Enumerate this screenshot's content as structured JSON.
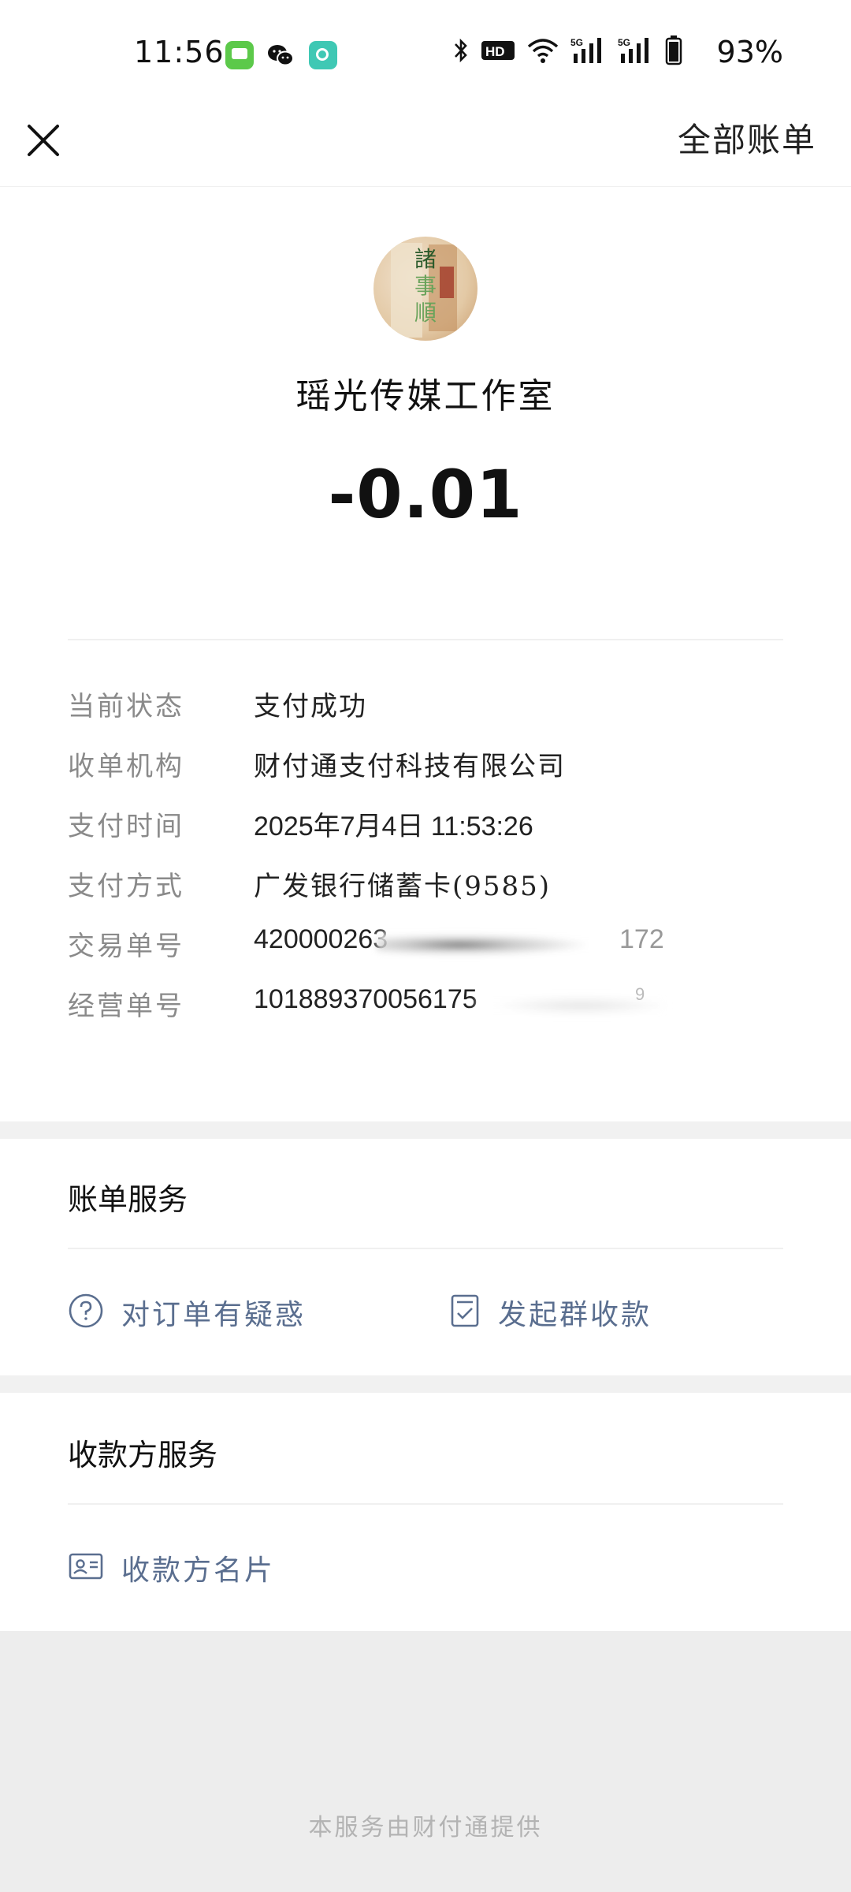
{
  "status_bar": {
    "time": "11:56",
    "battery": "93%",
    "icons": [
      "messages-app-icon",
      "wechat-icon",
      "quark-app-icon",
      "bluetooth-icon",
      "hd-voice-icon",
      "wifi-icon",
      "5g-signal-icon",
      "5g-signal-icon",
      "battery-icon"
    ]
  },
  "nav": {
    "close_icon": "close-icon",
    "all_bills": "全部账单"
  },
  "merchant": {
    "name": "瑶光传媒工作室",
    "amount": "-0.01"
  },
  "details": {
    "rows": [
      {
        "label": "当前状态",
        "value": "支付成功"
      },
      {
        "label": "收单机构",
        "value": "财付通支付科技有限公司"
      },
      {
        "label": "支付时间",
        "value": "2025年7月4日  11:53:26"
      },
      {
        "label": "支付方式",
        "value": "广发银行储蓄卡(9585)"
      },
      {
        "label": "交易单号",
        "value": "420000263",
        "tail": "172"
      },
      {
        "label": "经营单号",
        "value": "101889370056175",
        "tail": "9"
      }
    ]
  },
  "bill_services": {
    "title": "账单服务",
    "items": [
      {
        "label": "对订单有疑惑",
        "icon": "question-circle-icon"
      },
      {
        "label": "发起群收款",
        "icon": "checklist-icon"
      }
    ]
  },
  "payee_services": {
    "title": "收款方服务",
    "items": [
      {
        "label": "收款方名片",
        "icon": "business-card-icon"
      }
    ]
  },
  "footer": {
    "text": "本服务由财付通提供"
  },
  "colors": {
    "service_link": "#5a6e8f",
    "label_gray": "#8a8a8a",
    "band_gray": "#f1f1f1"
  }
}
